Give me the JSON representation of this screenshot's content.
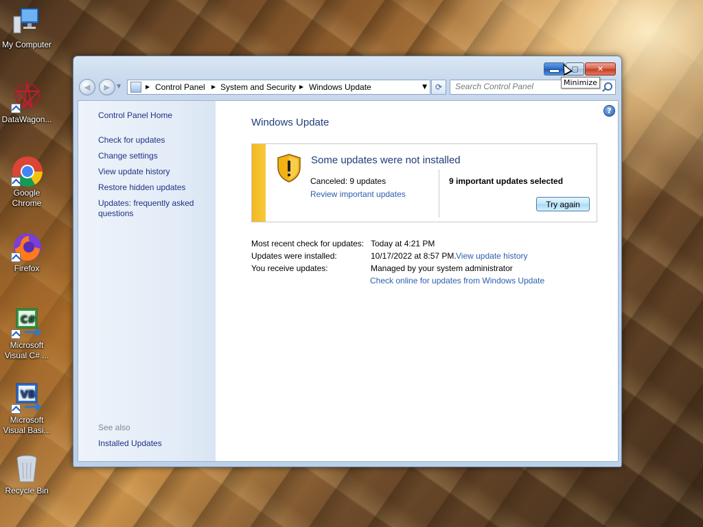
{
  "desktop": {
    "icons": [
      {
        "label": "My Computer",
        "icon": "computer-icon"
      },
      {
        "label": "DataWagon...",
        "icon": "datawagon-icon"
      },
      {
        "label": "Google Chrome",
        "icon": "chrome-icon"
      },
      {
        "label": "Firefox",
        "icon": "firefox-icon"
      },
      {
        "label": "Microsoft Visual C# ...",
        "icon": "visual-csharp-icon"
      },
      {
        "label": "Microsoft Visual Basi...",
        "icon": "visual-basic-icon"
      },
      {
        "label": "Recycle Bin",
        "icon": "recycle-bin-icon"
      }
    ]
  },
  "window": {
    "tooltip": "Minimize",
    "breadcrumbs": [
      "Control Panel",
      "System and Security",
      "Windows Update"
    ],
    "search_placeholder": "Search Control Panel"
  },
  "sidebar": {
    "home": "Control Panel Home",
    "links": [
      "Check for updates",
      "Change settings",
      "View update history",
      "Restore hidden updates",
      "Updates: frequently asked questions"
    ],
    "see_also": "See also",
    "installed_updates": "Installed Updates"
  },
  "main": {
    "title": "Windows Update",
    "status": {
      "heading": "Some updates were not installed",
      "canceled": "Canceled: 9 updates",
      "review_link": "Review important updates",
      "selected": "9 important updates selected",
      "try_again": "Try again",
      "accent_color": "#f3b823"
    },
    "info": {
      "recent_check_label": "Most recent check for updates:",
      "recent_check_value": "Today at 4:21 PM",
      "installed_label": "Updates were installed:",
      "installed_value": "10/17/2022 at 8:57 PM.",
      "history_link": "View update history",
      "receive_label": "You receive updates:",
      "receive_value": "Managed by your system administrator",
      "online_link": "Check online for updates from Windows Update"
    }
  }
}
